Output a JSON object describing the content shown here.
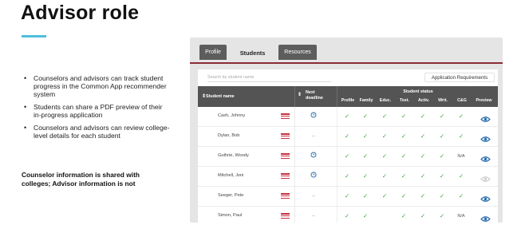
{
  "slide": {
    "title": "Advisor role",
    "bullets": [
      "Counselors and advisors can track student progress in the Common App recommender system",
      "Students can share a PDF preview of their in-progress application",
      "Counselors and advisors can review college-level details for each student"
    ],
    "note": "Counselor information is shared with colleges; Advisor information is not",
    "accent_color": "#4dbfdc"
  },
  "app": {
    "tabs": [
      {
        "label": "Profile",
        "active": false
      },
      {
        "label": "Students",
        "active": true
      },
      {
        "label": "Resources",
        "active": false
      }
    ],
    "brand_color": "#8a2b36",
    "search_placeholder": "Search by student name",
    "requirements_button": "Application Requirements",
    "table": {
      "student_name_header": "Student name",
      "next_deadline_header": "Next deadline",
      "student_status_header": "Student status",
      "status_columns": [
        "Profile",
        "Family",
        "Educ.",
        "Test.",
        "Activ.",
        "Writ.",
        "C&G",
        "Preview"
      ],
      "rows": [
        {
          "name": "Cash, Johnny",
          "deadline": "clock",
          "statuses": [
            "✓",
            "✓",
            "✓",
            "✓",
            "✓",
            "✓",
            "✓"
          ],
          "preview": "active"
        },
        {
          "name": "Dylan, Bob",
          "deadline": "–",
          "statuses": [
            "✓",
            "✓",
            "✓",
            "✓",
            "✓",
            "✓",
            "✓"
          ],
          "preview": "active"
        },
        {
          "name": "Guthrie, Woody",
          "deadline": "clock",
          "statuses": [
            "✓",
            "✓",
            "✓",
            "✓",
            "✓",
            "✓",
            "N/A"
          ],
          "preview": "active"
        },
        {
          "name": "Mitchell, Joni",
          "deadline": "clock",
          "statuses": [
            "✓",
            "✓",
            "✓",
            "✓",
            "✓",
            "✓",
            "✓"
          ],
          "preview": "inactive"
        },
        {
          "name": "Seeger, Pete",
          "deadline": "–",
          "statuses": [
            "✓",
            "✓",
            "✓",
            "✓",
            "✓",
            "✓",
            "✓"
          ],
          "preview": "active"
        },
        {
          "name": "Simon, Paul",
          "deadline": "–",
          "statuses": [
            "✓",
            "✓",
            "",
            "✓",
            "✓",
            "✓",
            "N/A"
          ],
          "preview": "active"
        }
      ]
    }
  }
}
